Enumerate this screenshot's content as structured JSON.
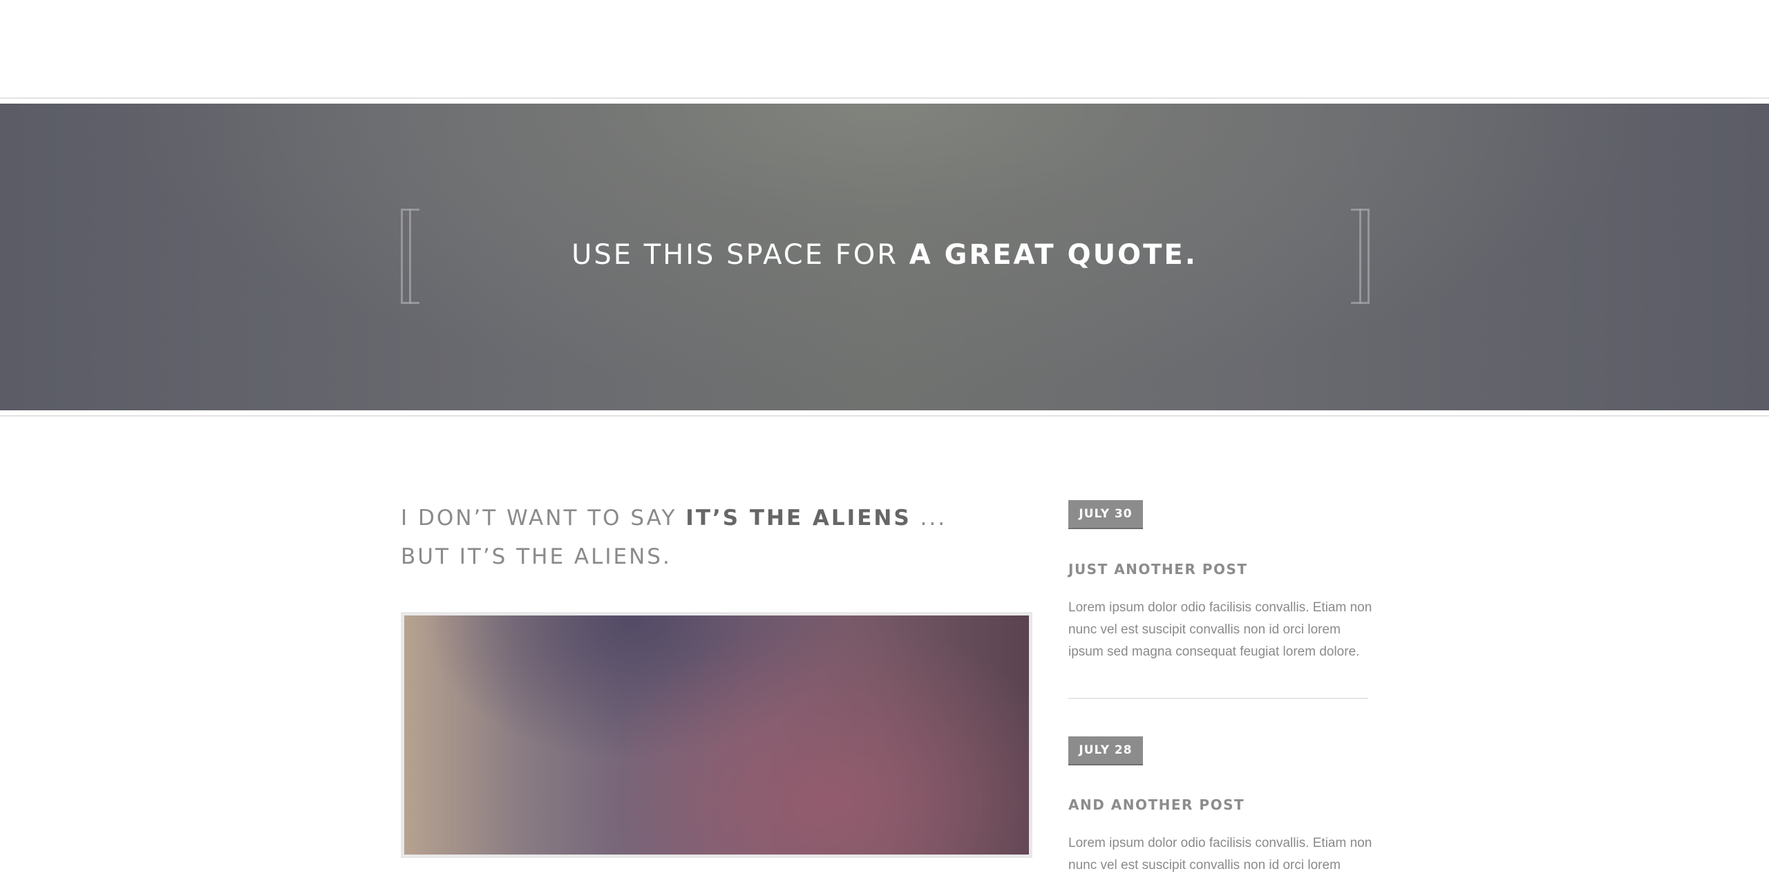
{
  "quote": {
    "prefix": "USE THIS SPACE FOR ",
    "emphasis": "A GREAT QUOTE",
    "suffix": "."
  },
  "headline": {
    "prefix": "I DON’T WANT TO SAY ",
    "emphasis": "IT’S THE ALIENS",
    "suffix": " ...",
    "line2": "BUT IT’S THE ALIENS."
  },
  "posts": [
    {
      "date": "JULY 30",
      "title": "JUST ANOTHER POST",
      "text": "Lorem ipsum dolor odio facilisis convallis. Etiam non nunc vel est suscipit convallis non id orci lorem ipsum sed magna consequat feugiat lorem dolore."
    },
    {
      "date": "JULY 28",
      "title": "AND ANOTHER POST",
      "text": "Lorem ipsum dolor odio facilisis convallis. Etiam non nunc vel est suscipit convallis non id orci lorem ipsum"
    }
  ]
}
